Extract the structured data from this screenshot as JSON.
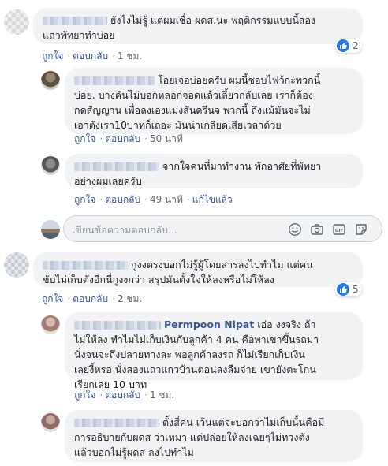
{
  "actions": {
    "like": "ถูกใจ",
    "reply": "ตอบกลับ",
    "edited": "แก้ไขแล้ว"
  },
  "comments": [
    {
      "text_l1": "ยังไงไม่รู้ แต่ผมเชื่อ ผดส.นะ พฤติกรรมแบบนี้สอง",
      "text_l2": "แถวพัทยาทำบ่อย",
      "time": "1 ชม.",
      "reactions": "2"
    },
    {
      "text_l1": "โอยเจอบ่อยครับ ผมนี้ชอบไฟว้กะพวกนี้",
      "text_l2": "บ่อย. บางคันไม่บอกหลอกจอดแล้วเลี้ยวกลับเลย เราก็ต้อง",
      "text_l3": "กดสัญญาน เพื่อลงเองแม่งสันดรีนจ พวกนี้ ถึงแม้มันจะไม่",
      "text_l4": "เอาตังเรา10บาทก็เถอะ มันน่าเกลียดเสียเวลาด้วย",
      "time": "50 นาที"
    },
    {
      "text_l1": "จากใจคนที่มาทำงาน พักอาศัยที่พัทยา",
      "text_l2": "อย่างผมเลยครับ",
      "time": "49 นาที"
    },
    {
      "text_l1": "กูงงตรงบอกไม่รู้ผู้โดยสารลงไปทำไม แต่คน",
      "text_l2": "ขับไม่เก็บตังอีกนี่กูงงกว่า สรุปมันตั้งใจให้ลงหรือไม่ให้ลง",
      "time": "2 ชม.",
      "reactions": "5"
    },
    {
      "name": "Permpoon Nipat",
      "text_l1": "เอ่อ งงจริง ถ้า",
      "text_l2": "ไม่ให้ลง ทำไมไม่เก็บเงินกับลูกค้า 4 คน คือพาเขาขึ้นรถมา",
      "text_l3": "นั่งจนจะถึงปลายทางละ พอลูกค้าลงรถ ก็ไม่เรียกเก็บเงิน",
      "text_l4": "เลยงี้หรอ นั่งสองแถวแถวบ้านตอนลงลืมจ่าย เขายังตะโกน",
      "text_l5": "เรียกเลย 10 บาท",
      "time": "1 ชม."
    },
    {
      "text_l1": "ตั้งสี่คน เว้นแต่จะบอกว่าไม่เก็บนั้นคือมี",
      "text_l2": "การอธิบายกับผดส ว่าเหมา แต่ปล่อยให้ลงเฉยๆไม่ทวงตัง",
      "text_l3": "แล้วบอกไม่รู้ผดส ลงไปทำไม"
    }
  ],
  "reply_box": {
    "placeholder": "เขียนข้อความตอบกลับ..."
  },
  "icons": [
    "emoji-icon",
    "camera-icon",
    "gif-icon",
    "sticker-icon",
    "like-icon"
  ],
  "colors": {
    "link": "#385898",
    "bubble": "#f2f3f5",
    "like_badge": "#2078f4",
    "meta": "#606770"
  }
}
